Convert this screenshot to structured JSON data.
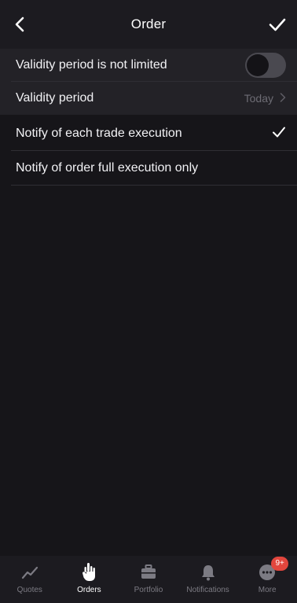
{
  "header": {
    "title": "Order",
    "back_icon": "chevron-left-icon",
    "confirm_icon": "checkmark-icon"
  },
  "settings": {
    "validity_unlimited": {
      "label": "Validity period is not limited",
      "enabled": false
    },
    "validity_period": {
      "label": "Validity period",
      "value": "Today"
    },
    "notify_each": {
      "label": "Notify of each trade execution",
      "selected": true
    },
    "notify_full": {
      "label": "Notify of order full execution only",
      "selected": false
    }
  },
  "tabbar": {
    "tabs": [
      {
        "label": "Quotes",
        "icon": "chart-line-icon",
        "active": false
      },
      {
        "label": "Orders",
        "icon": "hand-pointer-icon",
        "active": true
      },
      {
        "label": "Portfolio",
        "icon": "briefcase-icon",
        "active": false
      },
      {
        "label": "Notifications",
        "icon": "bell-icon",
        "active": false
      },
      {
        "label": "More",
        "icon": "more-dots-icon",
        "active": false,
        "badge": "9+"
      }
    ]
  },
  "colors": {
    "background": "#161519",
    "row_background": "#232227",
    "accent_badge": "#e2463d",
    "muted_text": "#6d6c74"
  }
}
